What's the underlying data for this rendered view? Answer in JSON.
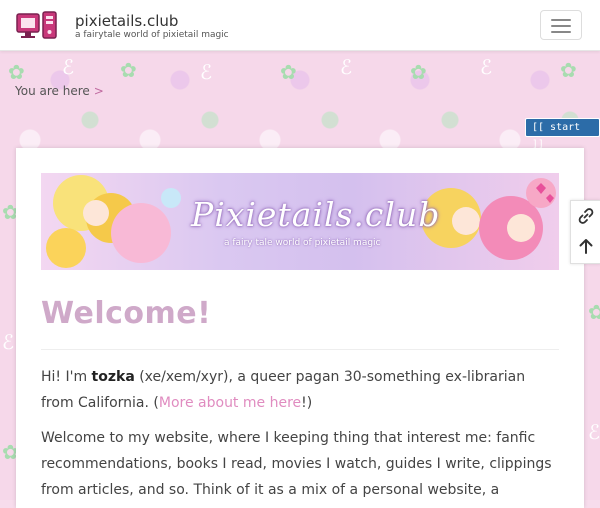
{
  "header": {
    "title": "pixietails.club",
    "tagline": "a fairytale world of pixietail magic",
    "logo_icon": "computer-icon",
    "menu_icon": "hamburger-icon"
  },
  "breadcrumb": {
    "label": "You are here",
    "separator": ">"
  },
  "start_link": "[[ start ]]",
  "banner": {
    "title": "Pixietails.club",
    "subtitle": "a fairy tale world of pixietail magic"
  },
  "content": {
    "heading": "Welcome!",
    "intro_prefix": "Hi! I'm ",
    "intro_name": "tozka",
    "intro_middle": " (xe/xem/xyr), a queer pagan 30-something ex-librarian from California. (",
    "intro_link": "More about me here",
    "intro_suffix": "!)",
    "para2": "Welcome to my website, where I keeping thing that interest me: fanfic recommendations, books I read, movies I watch, guides I write, clippings from articles, and so. Think of it as a mix of a personal website, a"
  },
  "pagetools": {
    "backlinks_icon": "link-icon",
    "top_icon": "arrow-up-icon"
  },
  "colors": {
    "accent_pink": "#e08cc0",
    "heading": "#cfa9c9",
    "start_button": "#2c6ca8"
  }
}
